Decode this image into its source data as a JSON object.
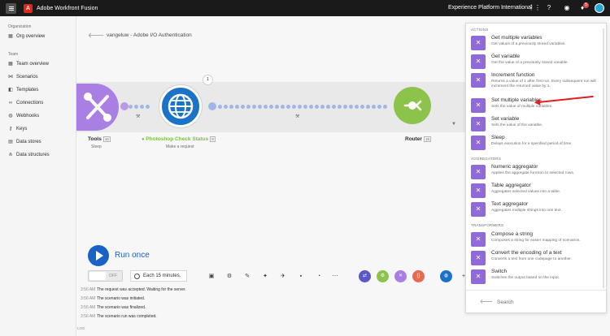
{
  "topbar": {
    "app_title": "Adobe Workfront Fusion",
    "org_name": "Experience Platform International",
    "notification_count": "5"
  },
  "sidebar": {
    "org_section": "Organization",
    "org_overview": "Org overview",
    "team_section": "Team",
    "items": [
      {
        "label": "Team overview",
        "icon": "team-icon"
      },
      {
        "label": "Scenarios",
        "icon": "share-icon"
      },
      {
        "label": "Templates",
        "icon": "template-icon"
      },
      {
        "label": "Connections",
        "icon": "link-icon"
      },
      {
        "label": "Webhooks",
        "icon": "globe-icon"
      },
      {
        "label": "Keys",
        "icon": "key-icon"
      },
      {
        "label": "Data stores",
        "icon": "database-icon"
      },
      {
        "label": "Data structures",
        "icon": "structure-icon"
      }
    ]
  },
  "scenario": {
    "title": "vangeluw - Adobe I/O Authentication",
    "bubble_count": "1"
  },
  "nodes": {
    "tools": {
      "label": "Tools",
      "badge": "10",
      "sub": "Sleep"
    },
    "photoshop": {
      "label": "Photoshop Check Status",
      "badge": "9",
      "sub": "Make a request"
    },
    "router": {
      "label": "Router",
      "badge": "16"
    }
  },
  "controls": {
    "run_label": "Run once",
    "toggle_state": "OFF",
    "schedule": "Each 15 minutes."
  },
  "log": {
    "label": "LOG",
    "rows": [
      {
        "time": "3:56 AM",
        "message": "The request was accepted. Waiting for the server."
      },
      {
        "time": "3:56 AM",
        "message": "The scenario was initiated."
      },
      {
        "time": "3:56 AM",
        "message": "The scenario was finalized."
      },
      {
        "time": "3:56 AM",
        "message": "The scenario run was completed."
      }
    ]
  },
  "panel": {
    "actions_section": "ACTIONS",
    "aggregators_section": "AGGREGATORS",
    "transformers_section": "TRANSFORMERS",
    "actions": [
      {
        "title": "Get multiple variables",
        "desc": "Get values of a previously stored variables."
      },
      {
        "title": "Get variable",
        "desc": "Get the value of a previously stored variable."
      },
      {
        "title": "Increment function",
        "desc": "Returns a value of 1 after first run. Every subsequent run will increment the returned value by 1."
      },
      {
        "title": "Set multiple variables",
        "desc": "Sets the value of multiple variables."
      },
      {
        "title": "Set variable",
        "desc": "Sets the value of the variable."
      },
      {
        "title": "Sleep",
        "desc": "Delays execution for a specified period of time."
      }
    ],
    "aggregators": [
      {
        "title": "Numeric aggregator",
        "desc": "Applies the aggregate function to selected rows."
      },
      {
        "title": "Table aggregator",
        "desc": "Aggregates selected values into a table."
      },
      {
        "title": "Text aggregator",
        "desc": "Aggregates multiple strings into one text."
      }
    ],
    "transformers": [
      {
        "title": "Compose a string",
        "desc": "Composes a string for easier mapping of scenarios."
      },
      {
        "title": "Convert the encoding of a text",
        "desc": "Converts a text from one codepage to another."
      },
      {
        "title": "Switch",
        "desc": "Switches the output based on the input."
      }
    ],
    "search_placeholder": "Search"
  },
  "colors": {
    "accent_blue": "#1a62c4",
    "tools_purple": "#a97fe3",
    "router_green": "#8cc34b",
    "highlight_arrow": "#e01e1e"
  }
}
